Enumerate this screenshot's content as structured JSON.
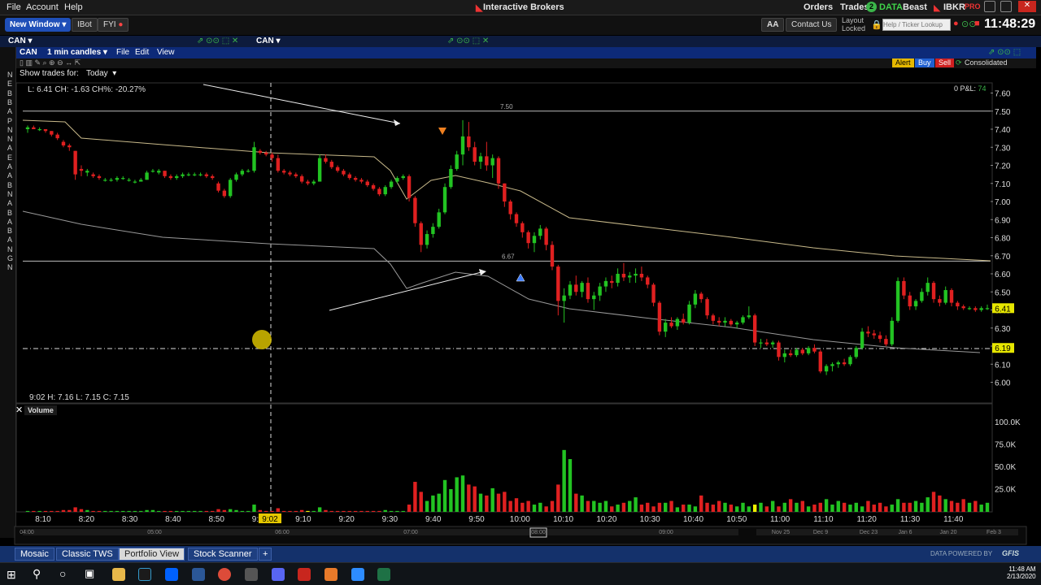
{
  "menu": {
    "file": "File",
    "account": "Account",
    "help": "Help",
    "app_title": "Interactive Brokers",
    "orders": "Orders",
    "trades": "Trades",
    "trades_count": "2",
    "data": "DATA",
    "user": "Beast",
    "brand": "IBKR",
    "brand_suffix": "PRO",
    "clock": "11:48:29"
  },
  "toolbar": {
    "new_window": "New Window",
    "ibot": "IBot",
    "fyi": "FYI",
    "aa": "AA",
    "contact": "Contact Us",
    "layout_locked_1": "Layout",
    "layout_locked_2": "Locked",
    "search_placeholder": "Help / Ticker Lookup"
  },
  "tabs": {
    "left": "CAN",
    "right": "CAN"
  },
  "chart_header": {
    "symbol": "CAN",
    "period": "1 min candles",
    "file": "File",
    "edit": "Edit",
    "view": "View",
    "alert": "Alert",
    "buy": "Buy",
    "sell": "Sell",
    "consolidated": "Consolidated"
  },
  "chart_sub": {
    "show_trades": "Show trades for:",
    "today": "Today"
  },
  "left_letters": [
    "N",
    "E",
    "B",
    "B",
    "A",
    "P",
    "N",
    "N",
    "A",
    "E",
    "A",
    "A",
    "B",
    "N",
    "A",
    "B",
    "A",
    "B",
    "A",
    "N",
    "G",
    "N"
  ],
  "info_line": "L: 6.41 CH: -1.63 CH%: -20.27%",
  "pnl": {
    "label": "0 P&L:",
    "value": "74"
  },
  "cursor_info": "9:02   H: 7.16  L: 7.15  C: 7.15",
  "volume_label": "Volume",
  "chart_data": {
    "type": "candlestick",
    "price_ticks": [
      "7.60",
      "7.50",
      "7.40",
      "7.30",
      "7.20",
      "7.10",
      "7.00",
      "6.90",
      "6.80",
      "6.70",
      "6.60",
      "6.50",
      "6.40",
      "6.30",
      "6.20",
      "6.10",
      "6.00"
    ],
    "ylim": [
      5.95,
      7.63
    ],
    "time_ticks": [
      "8:10",
      "8:20",
      "8:30",
      "8:40",
      "8:50",
      "9:00",
      "9:10",
      "9:20",
      "9:30",
      "9:40",
      "9:50",
      "10:00",
      "10:10",
      "10:20",
      "10:30",
      "10:40",
      "10:50",
      "11:00",
      "11:10",
      "11:20",
      "11:30",
      "11:40"
    ],
    "cursor_time": "9:02",
    "volume_ticks": [
      "100.0K",
      "75.0K",
      "50.0K",
      "25.0K"
    ],
    "price_tags": [
      {
        "value": 6.41,
        "label": "6.41",
        "color": "#e6e600"
      },
      {
        "value": 6.19,
        "label": "6.19",
        "color": "#e6e600"
      }
    ],
    "hlines": [
      {
        "value": 7.5,
        "label": "7.50"
      },
      {
        "value": 6.67,
        "label": "6.67"
      }
    ],
    "candles": [
      [
        7.4,
        7.42,
        7.38,
        7.41
      ],
      [
        7.41,
        7.42,
        7.4,
        7.4
      ],
      [
        7.4,
        7.41,
        7.39,
        7.4
      ],
      [
        7.4,
        7.4,
        7.38,
        7.39
      ],
      [
        7.39,
        7.39,
        7.36,
        7.37
      ],
      [
        7.37,
        7.38,
        7.34,
        7.35
      ],
      [
        7.33,
        7.34,
        7.3,
        7.31
      ],
      [
        7.31,
        7.32,
        7.28,
        7.3
      ],
      [
        7.28,
        7.28,
        7.12,
        7.15
      ],
      [
        7.18,
        7.2,
        7.14,
        7.17
      ],
      [
        7.16,
        7.18,
        7.14,
        7.17
      ],
      [
        7.15,
        7.16,
        7.13,
        7.14
      ],
      [
        7.14,
        7.15,
        7.12,
        7.13
      ],
      [
        7.12,
        7.13,
        7.11,
        7.12
      ],
      [
        7.12,
        7.13,
        7.11,
        7.12
      ],
      [
        7.12,
        7.14,
        7.11,
        7.13
      ],
      [
        7.13,
        7.14,
        7.12,
        7.13
      ],
      [
        7.12,
        7.13,
        7.11,
        7.12
      ],
      [
        7.11,
        7.12,
        7.1,
        7.11
      ],
      [
        7.11,
        7.13,
        7.11,
        7.12
      ],
      [
        7.12,
        7.17,
        7.12,
        7.16
      ],
      [
        7.17,
        7.18,
        7.16,
        7.17
      ],
      [
        7.16,
        7.18,
        7.15,
        7.17
      ],
      [
        7.17,
        7.17,
        7.13,
        7.14
      ],
      [
        7.14,
        7.15,
        7.12,
        7.13
      ],
      [
        7.13,
        7.15,
        7.12,
        7.14
      ],
      [
        7.14,
        7.16,
        7.13,
        7.15
      ],
      [
        7.15,
        7.16,
        7.14,
        7.15
      ],
      [
        7.15,
        7.16,
        7.14,
        7.15
      ],
      [
        7.15,
        7.16,
        7.14,
        7.15
      ],
      [
        7.15,
        7.16,
        7.13,
        7.14
      ],
      [
        7.14,
        7.15,
        7.12,
        7.13
      ],
      [
        7.1,
        7.11,
        7.05,
        7.06
      ],
      [
        7.06,
        7.07,
        7.02,
        7.03
      ],
      [
        7.03,
        7.13,
        7.02,
        7.12
      ],
      [
        7.12,
        7.16,
        7.11,
        7.15
      ],
      [
        7.15,
        7.18,
        7.14,
        7.17
      ],
      [
        7.17,
        7.18,
        7.16,
        7.17
      ],
      [
        7.17,
        7.33,
        7.16,
        7.3
      ],
      [
        7.28,
        7.29,
        7.26,
        7.27
      ],
      [
        7.27,
        7.28,
        7.25,
        7.26
      ],
      [
        7.26,
        7.27,
        7.22,
        7.24
      ],
      [
        7.24,
        7.26,
        7.16,
        7.17
      ],
      [
        7.17,
        7.18,
        7.15,
        7.16
      ],
      [
        7.16,
        7.17,
        7.14,
        7.15
      ],
      [
        7.15,
        7.16,
        7.13,
        7.14
      ],
      [
        7.14,
        7.15,
        7.1,
        7.11
      ],
      [
        7.11,
        7.12,
        7.09,
        7.1
      ],
      [
        7.1,
        7.12,
        7.09,
        7.11
      ],
      [
        7.11,
        7.26,
        7.11,
        7.24
      ],
      [
        7.24,
        7.26,
        7.21,
        7.22
      ],
      [
        7.22,
        7.23,
        7.18,
        7.19
      ],
      [
        7.19,
        7.2,
        7.16,
        7.17
      ],
      [
        7.17,
        7.18,
        7.14,
        7.15
      ],
      [
        7.15,
        7.16,
        7.12,
        7.13
      ],
      [
        7.13,
        7.14,
        7.11,
        7.12
      ],
      [
        7.12,
        7.13,
        7.1,
        7.11
      ],
      [
        7.11,
        7.12,
        7.08,
        7.09
      ],
      [
        7.09,
        7.1,
        7.06,
        7.07
      ],
      [
        7.07,
        7.08,
        7.03,
        7.04
      ],
      [
        7.04,
        7.09,
        7.03,
        7.08
      ],
      [
        7.08,
        7.12,
        7.07,
        7.11
      ],
      [
        7.11,
        7.14,
        7.1,
        7.13
      ],
      [
        7.13,
        7.15,
        7.12,
        7.14
      ],
      [
        7.14,
        7.15,
        7.0,
        7.02
      ],
      [
        7.02,
        7.03,
        6.86,
        6.88
      ],
      [
        6.88,
        6.89,
        6.72,
        6.76
      ],
      [
        6.76,
        6.84,
        6.74,
        6.82
      ],
      [
        6.82,
        6.88,
        6.8,
        6.86
      ],
      [
        6.86,
        6.96,
        6.85,
        6.94
      ],
      [
        6.94,
        7.1,
        6.93,
        7.08
      ],
      [
        7.08,
        7.2,
        7.07,
        7.18
      ],
      [
        7.18,
        7.28,
        7.17,
        7.26
      ],
      [
        7.26,
        7.45,
        7.2,
        7.36
      ],
      [
        7.36,
        7.44,
        7.28,
        7.3
      ],
      [
        7.3,
        7.33,
        7.2,
        7.22
      ],
      [
        7.22,
        7.27,
        7.18,
        7.25
      ],
      [
        7.25,
        7.33,
        7.17,
        7.2
      ],
      [
        7.2,
        7.26,
        7.13,
        7.24
      ],
      [
        7.24,
        7.25,
        7.07,
        7.1
      ],
      [
        7.1,
        7.1,
        6.97,
        7.0
      ],
      [
        7.0,
        7.01,
        6.9,
        6.93
      ],
      [
        6.93,
        6.94,
        6.86,
        6.88
      ],
      [
        6.88,
        6.89,
        6.8,
        6.83
      ],
      [
        6.83,
        6.84,
        6.74,
        6.77
      ],
      [
        6.77,
        6.83,
        6.72,
        6.81
      ],
      [
        6.81,
        6.87,
        6.79,
        6.85
      ],
      [
        6.85,
        6.86,
        6.73,
        6.76
      ],
      [
        6.76,
        6.78,
        6.62,
        6.64
      ],
      [
        6.64,
        6.65,
        6.37,
        6.45
      ],
      [
        6.45,
        6.52,
        6.33,
        6.48
      ],
      [
        6.48,
        6.56,
        6.46,
        6.54
      ],
      [
        6.54,
        6.59,
        6.48,
        6.5
      ],
      [
        6.5,
        6.56,
        6.47,
        6.55
      ],
      [
        6.55,
        6.58,
        6.44,
        6.46
      ],
      [
        6.46,
        6.5,
        6.4,
        6.48
      ],
      [
        6.48,
        6.55,
        6.45,
        6.53
      ],
      [
        6.53,
        6.58,
        6.5,
        6.56
      ],
      [
        6.56,
        6.59,
        6.52,
        6.55
      ],
      [
        6.55,
        6.63,
        6.53,
        6.6
      ],
      [
        6.6,
        6.66,
        6.56,
        6.58
      ],
      [
        6.58,
        6.61,
        6.55,
        6.59
      ],
      [
        6.59,
        6.63,
        6.55,
        6.6
      ],
      [
        6.6,
        6.64,
        6.56,
        6.58
      ],
      [
        6.58,
        6.59,
        6.52,
        6.54
      ],
      [
        6.54,
        6.55,
        6.42,
        6.44
      ],
      [
        6.44,
        6.45,
        6.26,
        6.28
      ],
      [
        6.28,
        6.35,
        6.25,
        6.33
      ],
      [
        6.33,
        6.36,
        6.3,
        6.31
      ],
      [
        6.31,
        6.36,
        6.29,
        6.35
      ],
      [
        6.35,
        6.38,
        6.32,
        6.33
      ],
      [
        6.33,
        6.45,
        6.32,
        6.43
      ],
      [
        6.43,
        6.51,
        6.41,
        6.49
      ],
      [
        6.49,
        6.5,
        6.44,
        6.46
      ],
      [
        6.46,
        6.47,
        6.35,
        6.37
      ],
      [
        6.37,
        6.38,
        6.32,
        6.34
      ],
      [
        6.34,
        6.36,
        6.31,
        6.33
      ],
      [
        6.33,
        6.36,
        6.31,
        6.34
      ],
      [
        6.34,
        6.35,
        6.31,
        6.32
      ],
      [
        6.32,
        6.34,
        6.3,
        6.33
      ],
      [
        6.33,
        6.37,
        6.32,
        6.36
      ],
      [
        6.36,
        6.42,
        6.35,
        6.37
      ],
      [
        6.37,
        6.38,
        6.2,
        6.22
      ],
      [
        6.22,
        6.24,
        6.19,
        6.22
      ],
      [
        6.22,
        6.24,
        6.2,
        6.21
      ],
      [
        6.21,
        6.23,
        6.19,
        6.22
      ],
      [
        6.22,
        6.23,
        6.12,
        6.14
      ],
      [
        6.14,
        6.18,
        6.11,
        6.16
      ],
      [
        6.16,
        6.18,
        6.14,
        6.15
      ],
      [
        6.15,
        6.19,
        6.14,
        6.18
      ],
      [
        6.18,
        6.19,
        6.15,
        6.16
      ],
      [
        6.16,
        6.2,
        6.15,
        6.19
      ],
      [
        6.19,
        6.21,
        6.16,
        6.17
      ],
      [
        6.17,
        6.18,
        6.05,
        6.06
      ],
      [
        6.06,
        6.1,
        6.04,
        6.09
      ],
      [
        6.09,
        6.11,
        6.06,
        6.1
      ],
      [
        6.1,
        6.12,
        6.08,
        6.11
      ],
      [
        6.11,
        6.13,
        6.09,
        6.1
      ],
      [
        6.1,
        6.15,
        6.09,
        6.14
      ],
      [
        6.14,
        6.2,
        6.13,
        6.19
      ],
      [
        6.19,
        6.3,
        6.18,
        6.28
      ],
      [
        6.28,
        6.31,
        6.25,
        6.27
      ],
      [
        6.27,
        6.29,
        6.24,
        6.26
      ],
      [
        6.26,
        6.28,
        6.22,
        6.24
      ],
      [
        6.24,
        6.26,
        6.2,
        6.21
      ],
      [
        6.21,
        6.36,
        6.2,
        6.34
      ],
      [
        6.34,
        6.58,
        6.33,
        6.56
      ],
      [
        6.56,
        6.58,
        6.46,
        6.48
      ],
      [
        6.48,
        6.5,
        6.4,
        6.42
      ],
      [
        6.42,
        6.46,
        6.4,
        6.45
      ],
      [
        6.45,
        6.52,
        6.44,
        6.5
      ],
      [
        6.5,
        6.58,
        6.48,
        6.55
      ],
      [
        6.55,
        6.56,
        6.44,
        6.46
      ],
      [
        6.46,
        6.48,
        6.42,
        6.44
      ],
      [
        6.44,
        6.53,
        6.43,
        6.51
      ],
      [
        6.51,
        6.52,
        6.42,
        6.44
      ],
      [
        6.44,
        6.45,
        6.4,
        6.42
      ],
      [
        6.42,
        6.43,
        6.4,
        6.41
      ],
      [
        6.41,
        6.42,
        6.4,
        6.41
      ],
      [
        6.41,
        6.42,
        6.39,
        6.4
      ],
      [
        6.4,
        6.42,
        6.39,
        6.41
      ],
      [
        6.41,
        6.43,
        6.4,
        6.41
      ]
    ],
    "volumes": [
      1,
      1,
      1,
      1,
      1,
      1,
      2,
      2,
      5,
      3,
      2,
      1,
      1,
      1,
      1,
      1,
      1,
      1,
      1,
      1,
      2,
      2,
      1,
      1,
      1,
      1,
      1,
      1,
      1,
      1,
      1,
      1,
      3,
      2,
      3,
      2,
      1,
      1,
      8,
      2,
      1,
      1,
      4,
      1,
      1,
      1,
      2,
      1,
      1,
      5,
      2,
      1,
      1,
      1,
      1,
      1,
      1,
      1,
      1,
      1,
      2,
      1,
      1,
      1,
      8,
      33,
      22,
      12,
      18,
      20,
      35,
      25,
      38,
      40,
      30,
      28,
      20,
      18,
      26,
      20,
      22,
      12,
      15,
      10,
      12,
      8,
      10,
      6,
      12,
      30,
      68,
      58,
      20,
      18,
      12,
      12,
      10,
      12,
      6,
      8,
      10,
      12,
      16,
      8,
      10,
      6,
      10,
      10,
      12,
      5,
      8,
      8,
      6,
      18,
      10,
      8,
      12,
      10,
      8,
      6,
      10,
      6,
      8,
      10,
      6,
      12,
      6,
      10,
      14,
      10,
      12,
      6,
      8,
      10,
      14,
      8,
      12,
      10,
      8,
      10,
      6,
      12,
      8,
      10,
      6,
      8,
      14,
      10,
      10,
      12,
      10,
      16,
      22,
      18,
      14,
      12,
      10,
      14,
      10,
      12,
      8,
      10,
      6,
      8,
      6,
      4,
      6
    ]
  },
  "bottom_tabs": [
    "Mosaic",
    "Classic TWS",
    "Portfolio View",
    "Stock Scanner",
    "+"
  ],
  "bottom_right": "DATA POWERED BY",
  "bottom_brand": "GFIS",
  "nav_dates": [
    "04:00",
    "05:00",
    "06:00",
    "07:00",
    "08:00",
    "09:00",
    "Nov 25",
    "Dec 9",
    "Dec 23",
    "Jan 6",
    "Jan 20",
    "Feb 3"
  ],
  "taskbar": {
    "time": "11:48 AM",
    "date": "2/13/2020"
  }
}
